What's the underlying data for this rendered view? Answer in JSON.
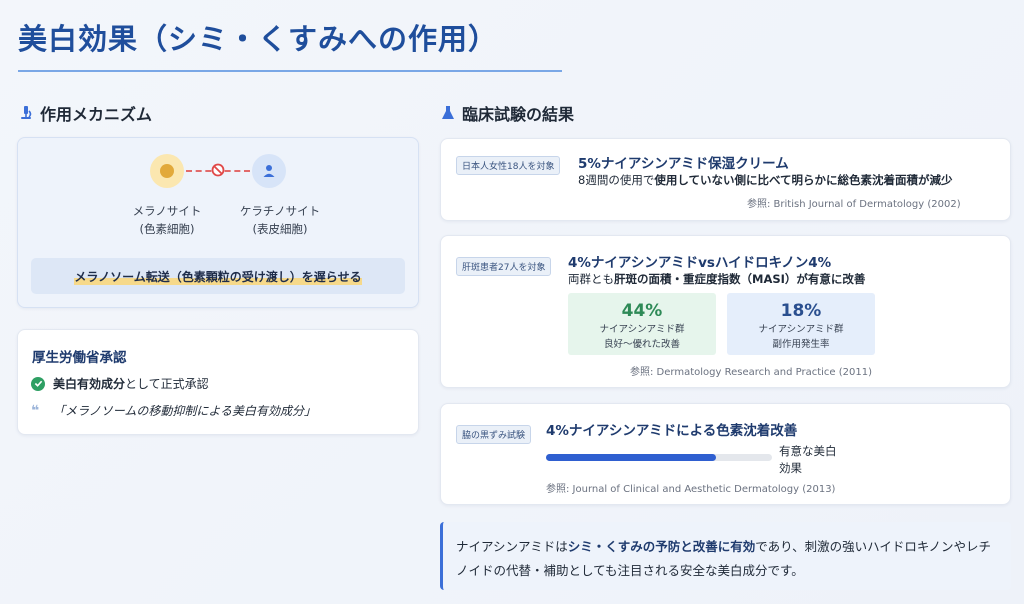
{
  "title": "美白効果（シミ・くすみへの作用）",
  "mechanism": {
    "heading": "作用メカニズム",
    "melanocyte_name": "メラノサイト",
    "melanocyte_sub": "(色素細胞)",
    "keratinocyte_name": "ケラチノサイト",
    "keratinocyte_sub": "(表皮細胞)",
    "banner": "メラノソーム転送（色素顆粒の受け渡し）を遅らせる"
  },
  "ministry": {
    "title": "厚生労働省承認",
    "approval_strong": "美白有効成分",
    "approval_rest": "として正式承認",
    "quote_mark": "❝",
    "quote": "「メラノソームの移動抑制による美白有効成分」"
  },
  "trials": {
    "heading": "臨床試験の結果",
    "t1": {
      "tag": "日本人女性18人を対象",
      "title": "5%ナイアシンアミド保湿クリーム",
      "text_plain": "8週間の使用で",
      "text_bold": "使用していない側に比べて明らかに総色素沈着面積が減少",
      "ref": "参照: British Journal of Dermatology (2002)"
    },
    "t2": {
      "tag": "肝斑患者27人を対象",
      "title": "4%ナイアシンアミドvsハイドロキノン4%",
      "text_plain": "両群とも",
      "text_bold": "肝斑の面積・重症度指数（MASI）が有意に改善",
      "stat1_value": "44%",
      "stat1_label1": "ナイアシンアミド群",
      "stat1_label2": "良好〜優れた改善",
      "stat2_value": "18%",
      "stat2_label1": "ナイアシンアミド群",
      "stat2_label2": "副作用発生率",
      "ref": "参照: Dermatology Research and Practice (2011)"
    },
    "t3": {
      "tag": "脇の黒ずみ試験",
      "title": "4%ナイアシンアミドによる色素沈着改善",
      "bar_fraction": 0.75,
      "bar_label1": "有意な美白",
      "bar_label2": "効果",
      "ref": "参照: Journal of Clinical and Aesthetic Dermatology (2013)"
    }
  },
  "summary": {
    "p1": "ナイアシンアミドは",
    "bold": "シミ・くすみの予防と改善に有効",
    "p2": "であり、刺激の強いハイドロキノンやレチノイドの代替・補助としても注目される安全な美白成分です。"
  },
  "colors": {
    "brand": "#1f4e9c",
    "accent": "#2f5fd0",
    "success": "#2e9f63"
  },
  "icons": [
    "microscope-icon",
    "flask-icon",
    "melanocyte-icon",
    "block-icon",
    "user-icon",
    "check-icon",
    "quote-icon"
  ]
}
